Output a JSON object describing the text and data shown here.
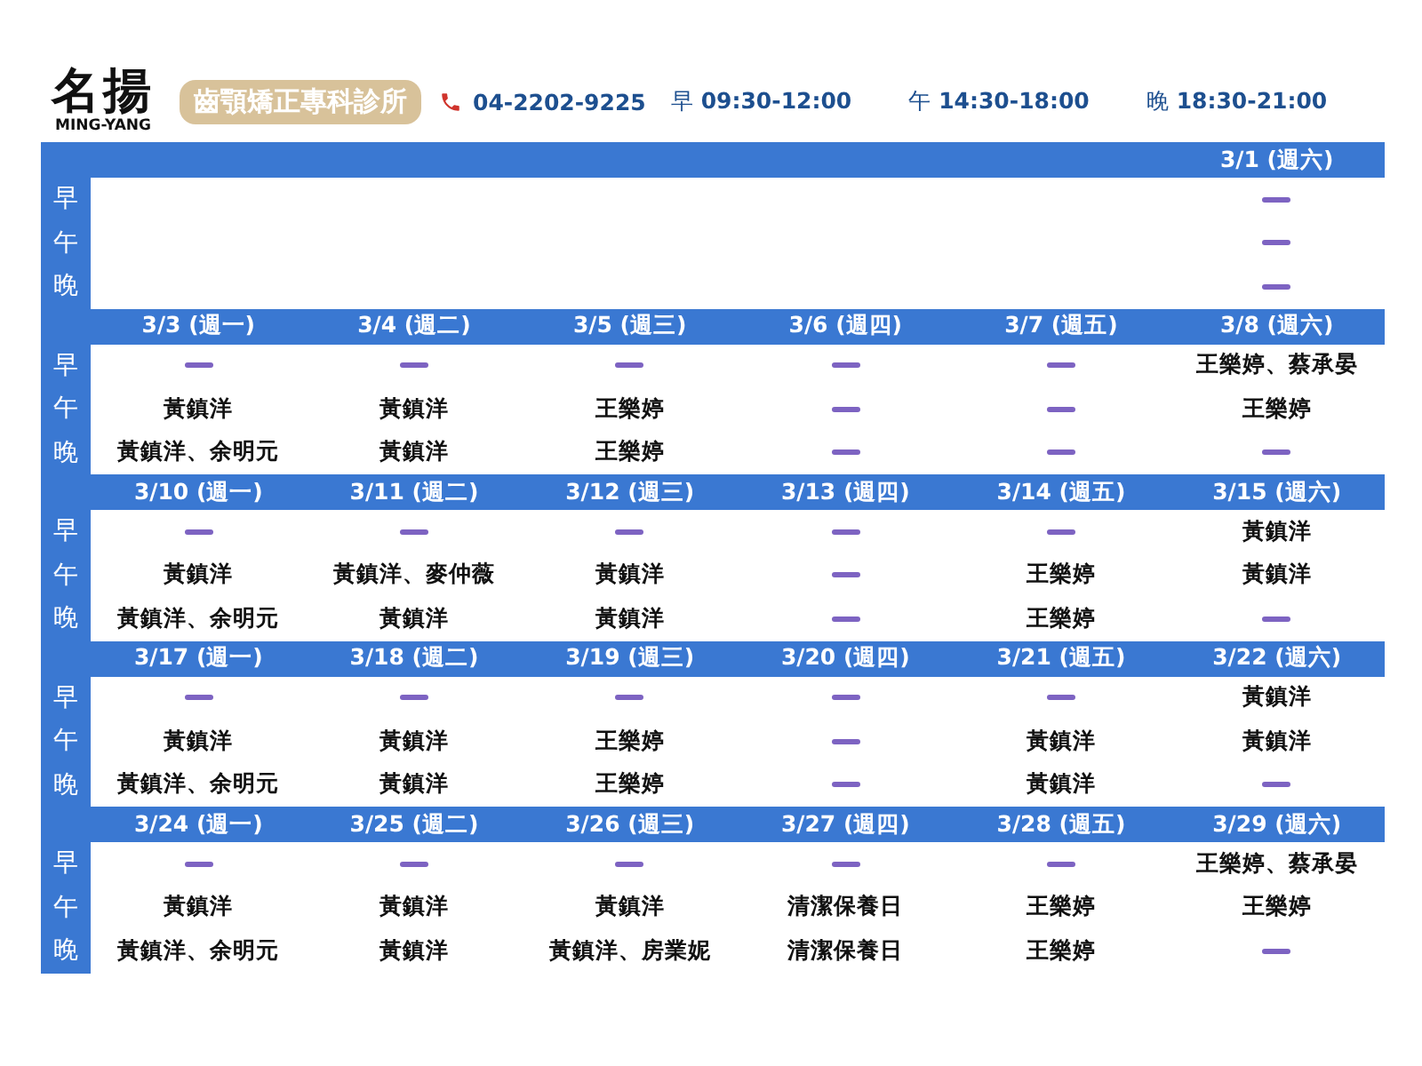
{
  "header": {
    "logo": "名揚",
    "logo_sub": "MING-YANG",
    "clinic": "齒顎矯正專科診所",
    "phone": "04-2202-9225",
    "hours": [
      {
        "label": "早",
        "time": "09:30-12:00"
      },
      {
        "label": "午",
        "time": "14:30-18:00"
      },
      {
        "label": "晚",
        "time": "18:30-21:00"
      }
    ]
  },
  "weeks": [
    {
      "slot_labels": [
        "早",
        "午",
        "晚"
      ],
      "days": [
        {
          "kind": "blank"
        },
        {
          "kind": "blank"
        },
        {
          "kind": "blank"
        },
        {
          "kind": "blank"
        },
        {
          "kind": "blank"
        },
        {
          "kind": "day",
          "date": "3/1 (週六)",
          "slots": [
            {
              "kind": "closed"
            },
            {
              "kind": "closed"
            },
            {
              "kind": "closed"
            }
          ]
        }
      ]
    },
    {
      "slot_labels": [
        "早",
        "午",
        "晚"
      ],
      "days": [
        {
          "kind": "day",
          "date": "3/3 (週一)",
          "slots": [
            {
              "kind": "closed"
            },
            {
              "kind": "text",
              "text": "黃鎮洋"
            },
            {
              "kind": "text",
              "text": "黃鎮洋、余明元"
            }
          ]
        },
        {
          "kind": "day",
          "date": "3/4 (週二)",
          "slots": [
            {
              "kind": "closed"
            },
            {
              "kind": "text",
              "text": "黃鎮洋"
            },
            {
              "kind": "text",
              "text": "黃鎮洋"
            }
          ]
        },
        {
          "kind": "day",
          "date": "3/5 (週三)",
          "slots": [
            {
              "kind": "closed"
            },
            {
              "kind": "text",
              "text": "王樂婷"
            },
            {
              "kind": "text",
              "text": "王樂婷"
            }
          ]
        },
        {
          "kind": "day",
          "date": "3/6 (週四)",
          "slots": [
            {
              "kind": "closed"
            },
            {
              "kind": "closed"
            },
            {
              "kind": "closed"
            }
          ]
        },
        {
          "kind": "day",
          "date": "3/7 (週五)",
          "slots": [
            {
              "kind": "closed"
            },
            {
              "kind": "closed"
            },
            {
              "kind": "closed"
            }
          ]
        },
        {
          "kind": "day",
          "date": "3/8 (週六)",
          "slots": [
            {
              "kind": "text",
              "text": "王樂婷、蔡承晏"
            },
            {
              "kind": "text",
              "text": "王樂婷"
            },
            {
              "kind": "closed"
            }
          ]
        }
      ]
    },
    {
      "slot_labels": [
        "早",
        "午",
        "晚"
      ],
      "days": [
        {
          "kind": "day",
          "date": "3/10 (週一)",
          "slots": [
            {
              "kind": "closed"
            },
            {
              "kind": "text",
              "text": "黃鎮洋"
            },
            {
              "kind": "text",
              "text": "黃鎮洋、余明元"
            }
          ]
        },
        {
          "kind": "day",
          "date": "3/11 (週二)",
          "slots": [
            {
              "kind": "closed"
            },
            {
              "kind": "text",
              "text": "黃鎮洋、麥仲薇"
            },
            {
              "kind": "text",
              "text": "黃鎮洋"
            }
          ]
        },
        {
          "kind": "day",
          "date": "3/12 (週三)",
          "slots": [
            {
              "kind": "closed"
            },
            {
              "kind": "text",
              "text": "黃鎮洋"
            },
            {
              "kind": "text",
              "text": "黃鎮洋"
            }
          ]
        },
        {
          "kind": "day",
          "date": "3/13 (週四)",
          "slots": [
            {
              "kind": "closed"
            },
            {
              "kind": "closed"
            },
            {
              "kind": "closed"
            }
          ]
        },
        {
          "kind": "day",
          "date": "3/14 (週五)",
          "slots": [
            {
              "kind": "closed"
            },
            {
              "kind": "text",
              "text": "王樂婷"
            },
            {
              "kind": "text",
              "text": "王樂婷"
            }
          ]
        },
        {
          "kind": "day",
          "date": "3/15 (週六)",
          "slots": [
            {
              "kind": "text",
              "text": "黃鎮洋"
            },
            {
              "kind": "text",
              "text": "黃鎮洋"
            },
            {
              "kind": "closed"
            }
          ]
        }
      ]
    },
    {
      "slot_labels": [
        "早",
        "午",
        "晚"
      ],
      "days": [
        {
          "kind": "day",
          "date": "3/17 (週一)",
          "slots": [
            {
              "kind": "closed"
            },
            {
              "kind": "text",
              "text": "黃鎮洋"
            },
            {
              "kind": "text",
              "text": "黃鎮洋、余明元"
            }
          ]
        },
        {
          "kind": "day",
          "date": "3/18 (週二)",
          "slots": [
            {
              "kind": "closed"
            },
            {
              "kind": "text",
              "text": "黃鎮洋"
            },
            {
              "kind": "text",
              "text": "黃鎮洋"
            }
          ]
        },
        {
          "kind": "day",
          "date": "3/19 (週三)",
          "slots": [
            {
              "kind": "closed"
            },
            {
              "kind": "text",
              "text": "王樂婷"
            },
            {
              "kind": "text",
              "text": "王樂婷"
            }
          ]
        },
        {
          "kind": "day",
          "date": "3/20 (週四)",
          "slots": [
            {
              "kind": "closed"
            },
            {
              "kind": "closed"
            },
            {
              "kind": "closed"
            }
          ]
        },
        {
          "kind": "day",
          "date": "3/21 (週五)",
          "slots": [
            {
              "kind": "closed"
            },
            {
              "kind": "text",
              "text": "黃鎮洋"
            },
            {
              "kind": "text",
              "text": "黃鎮洋"
            }
          ]
        },
        {
          "kind": "day",
          "date": "3/22 (週六)",
          "slots": [
            {
              "kind": "text",
              "text": "黃鎮洋"
            },
            {
              "kind": "text",
              "text": "黃鎮洋"
            },
            {
              "kind": "closed"
            }
          ]
        }
      ]
    },
    {
      "slot_labels": [
        "早",
        "午",
        "晚"
      ],
      "days": [
        {
          "kind": "day",
          "date": "3/24 (週一)",
          "slots": [
            {
              "kind": "closed"
            },
            {
              "kind": "text",
              "text": "黃鎮洋"
            },
            {
              "kind": "text",
              "text": "黃鎮洋、余明元"
            }
          ]
        },
        {
          "kind": "day",
          "date": "3/25 (週二)",
          "slots": [
            {
              "kind": "closed"
            },
            {
              "kind": "text",
              "text": "黃鎮洋"
            },
            {
              "kind": "text",
              "text": "黃鎮洋"
            }
          ]
        },
        {
          "kind": "day",
          "date": "3/26 (週三)",
          "slots": [
            {
              "kind": "closed"
            },
            {
              "kind": "text",
              "text": "黃鎮洋"
            },
            {
              "kind": "text",
              "text": "黃鎮洋、房業妮"
            }
          ]
        },
        {
          "kind": "day",
          "date": "3/27 (週四)",
          "slots": [
            {
              "kind": "closed"
            },
            {
              "kind": "text",
              "text": "清潔保養日"
            },
            {
              "kind": "text",
              "text": "清潔保養日"
            }
          ]
        },
        {
          "kind": "day",
          "date": "3/28 (週五)",
          "slots": [
            {
              "kind": "closed"
            },
            {
              "kind": "text",
              "text": "王樂婷"
            },
            {
              "kind": "text",
              "text": "王樂婷"
            }
          ]
        },
        {
          "kind": "day",
          "date": "3/29 (週六)",
          "slots": [
            {
              "kind": "text",
              "text": "王樂婷、蔡承晏"
            },
            {
              "kind": "text",
              "text": "王樂婷"
            },
            {
              "kind": "closed"
            }
          ]
        }
      ]
    }
  ]
}
